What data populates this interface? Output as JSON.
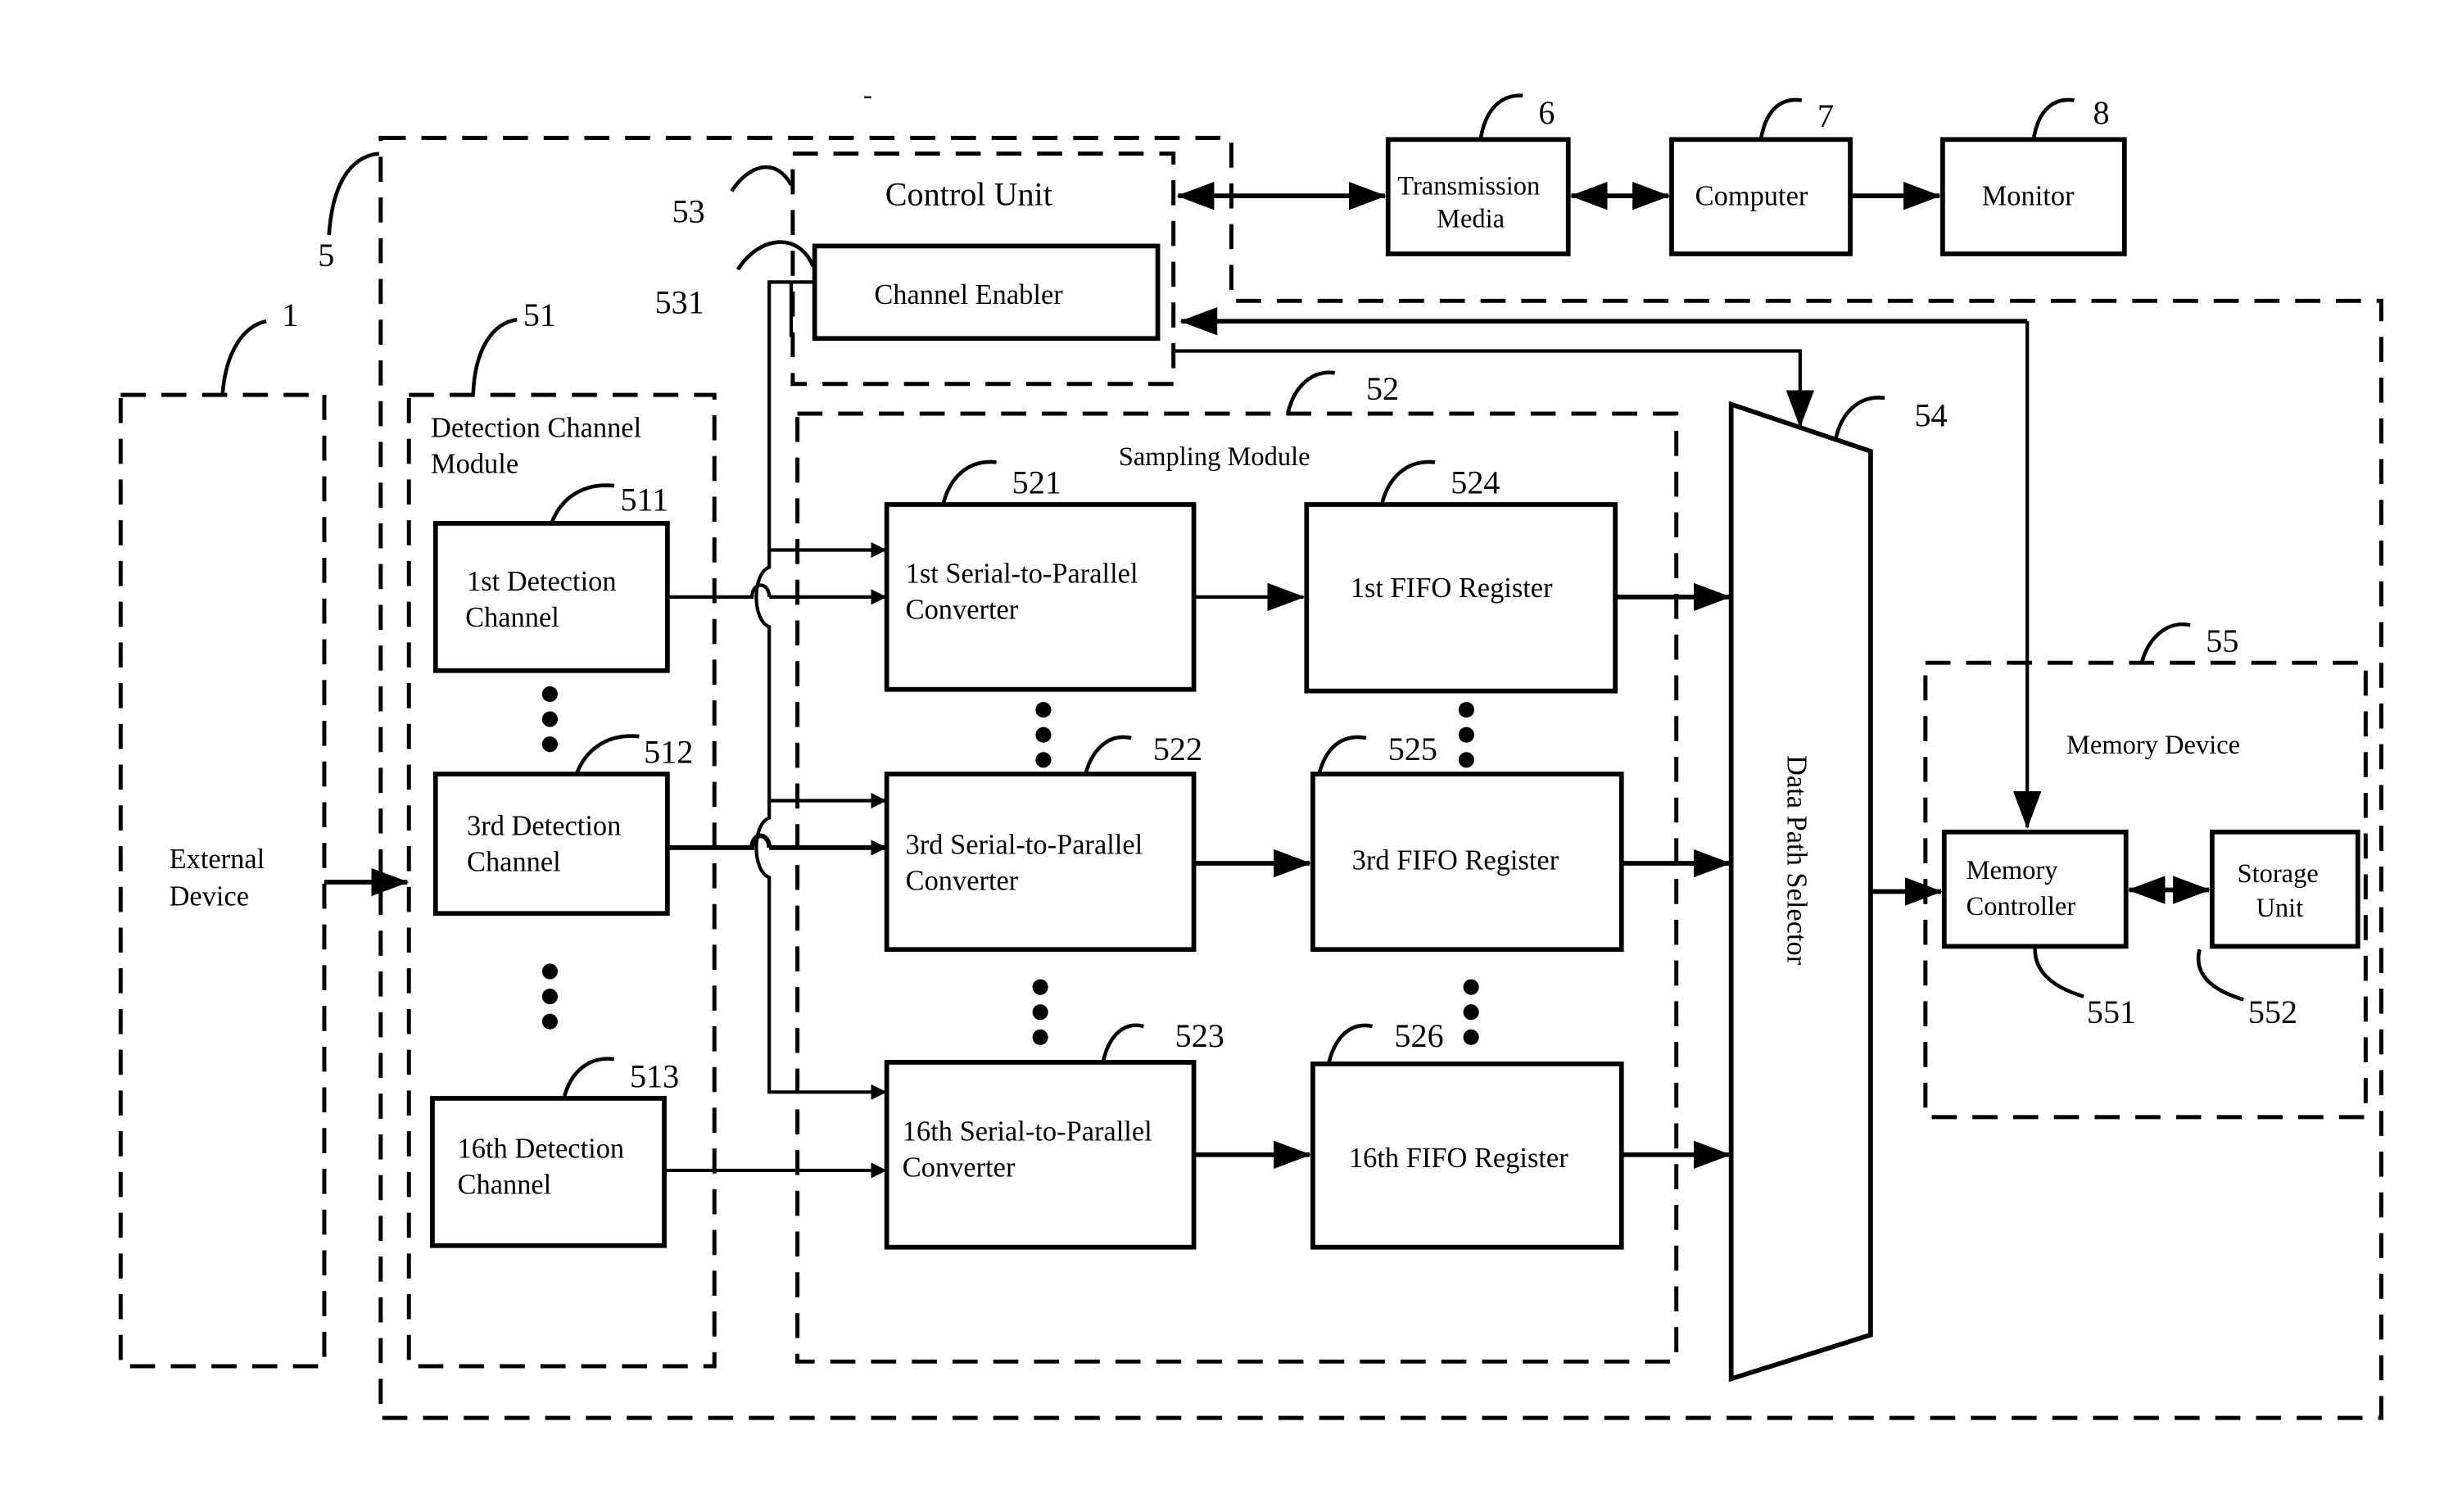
{
  "figure": {
    "external_device": {
      "ref": "1",
      "label_line1": "External",
      "label_line2": "Device"
    },
    "system": {
      "ref": "5"
    },
    "detection_channel_module": {
      "ref": "51",
      "label_line1": "Detection Channel",
      "label_line2": "Module",
      "channels": [
        {
          "ref": "511",
          "line1": "1st Detection",
          "line2": "Channel"
        },
        {
          "ref": "512",
          "line1": "3rd Detection",
          "line2": "Channel"
        },
        {
          "ref": "513",
          "line1": "16th Detection",
          "line2": "Channel"
        }
      ]
    },
    "sampling_module": {
      "ref": "52",
      "label": "Sampling Module",
      "converters": [
        {
          "ref": "521",
          "line1": "1st Serial-to-Parallel",
          "line2": "Converter"
        },
        {
          "ref": "522",
          "line1": "3rd Serial-to-Parallel",
          "line2": "Converter"
        },
        {
          "ref": "523",
          "line1": "16th Serial-to-Parallel",
          "line2": "Converter"
        }
      ],
      "fifos": [
        {
          "ref": "524",
          "label": "1st FIFO Register"
        },
        {
          "ref": "525",
          "label": "3rd FIFO Register"
        },
        {
          "ref": "526",
          "label": "16th FIFO Register"
        }
      ]
    },
    "control_unit": {
      "ref": "53",
      "label": "Control Unit",
      "channel_enabler": {
        "ref": "531",
        "label": "Channel Enabler"
      }
    },
    "data_path_selector": {
      "ref": "54",
      "label": "Data Path Selector"
    },
    "memory_device": {
      "ref": "55",
      "label": "Memory Device",
      "memory_controller": {
        "ref": "551",
        "line1": "Memory",
        "line2": "Controller"
      },
      "storage_unit": {
        "ref": "552",
        "line1": "Storage",
        "line2": "Unit"
      }
    },
    "transmission_media": {
      "ref": "6",
      "line1": "Transmission",
      "line2": "Media"
    },
    "computer": {
      "ref": "7",
      "label": "Computer"
    },
    "monitor": {
      "ref": "8",
      "label": "Monitor"
    }
  }
}
